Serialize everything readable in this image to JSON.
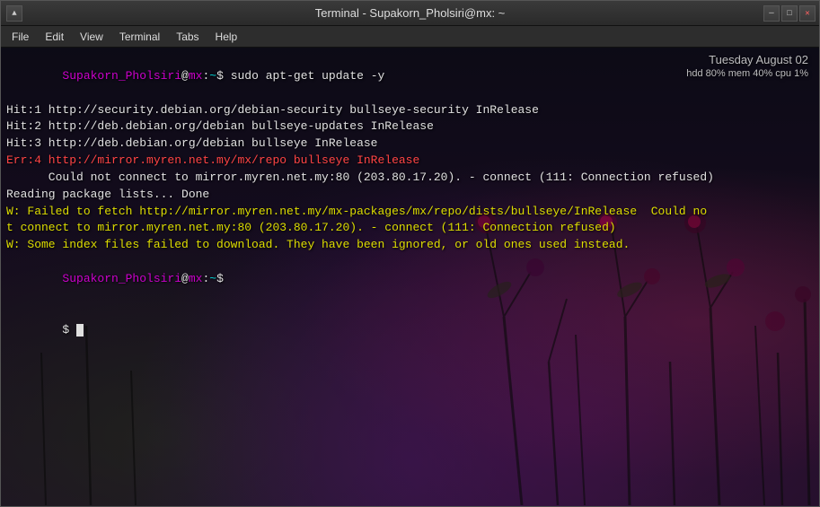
{
  "window": {
    "title": "Terminal - Supakorn_Pholsiri@mx: ~",
    "controls": {
      "minimize": "─",
      "maximize": "□",
      "close": "✕",
      "up_arrow": "▲"
    }
  },
  "menubar": {
    "items": [
      "File",
      "Edit",
      "View",
      "Terminal",
      "Tabs",
      "Help"
    ]
  },
  "sysinfo": {
    "date": "Tuesday  August 02",
    "resources": "hdd 80%  mem 40%  cpu  1%"
  },
  "terminal": {
    "lines": [
      {
        "type": "prompt_cmd",
        "user": "Supakorn_Pholsiri",
        "host": "mx",
        "path": "~",
        "cmd": " sudo apt-get update -y"
      },
      {
        "type": "output",
        "color": "white",
        "text": "Hit:1 http://security.debian.org/debian-security bullseye-security InRelease"
      },
      {
        "type": "output",
        "color": "white",
        "text": "Hit:2 http://deb.debian.org/debian bullseye-updates InRelease"
      },
      {
        "type": "output",
        "color": "white",
        "text": "Hit:3 http://deb.debian.org/debian bullseye InRelease"
      },
      {
        "type": "output",
        "color": "red",
        "text": "Err:4 http://mirror.myren.net.my/mx/repo bullseye InRelease"
      },
      {
        "type": "output",
        "color": "white",
        "text": "      Could not connect to mirror.myren.net.my:80 (203.80.17.20). - connect (111: Connection refused)"
      },
      {
        "type": "output",
        "color": "white",
        "text": "Reading package lists... Done"
      },
      {
        "type": "output",
        "color": "yellow",
        "text": "W: Failed to fetch http://mirror.myren.net.my/mx-packages/mx/repo/dists/bullseye/InRelease  Could no"
      },
      {
        "type": "output",
        "color": "yellow",
        "text": "t connect to mirror.myren.net.my:80 (203.80.17.20). - connect (111: Connection refused)"
      },
      {
        "type": "output",
        "color": "yellow",
        "text": "W: Some index files failed to download. They have been ignored, or old ones used instead."
      },
      {
        "type": "prompt_only",
        "user": "Supakorn_Pholsiri",
        "host": "mx",
        "path": "~"
      },
      {
        "type": "prompt_input",
        "dollar": "$",
        "input": ""
      }
    ]
  }
}
